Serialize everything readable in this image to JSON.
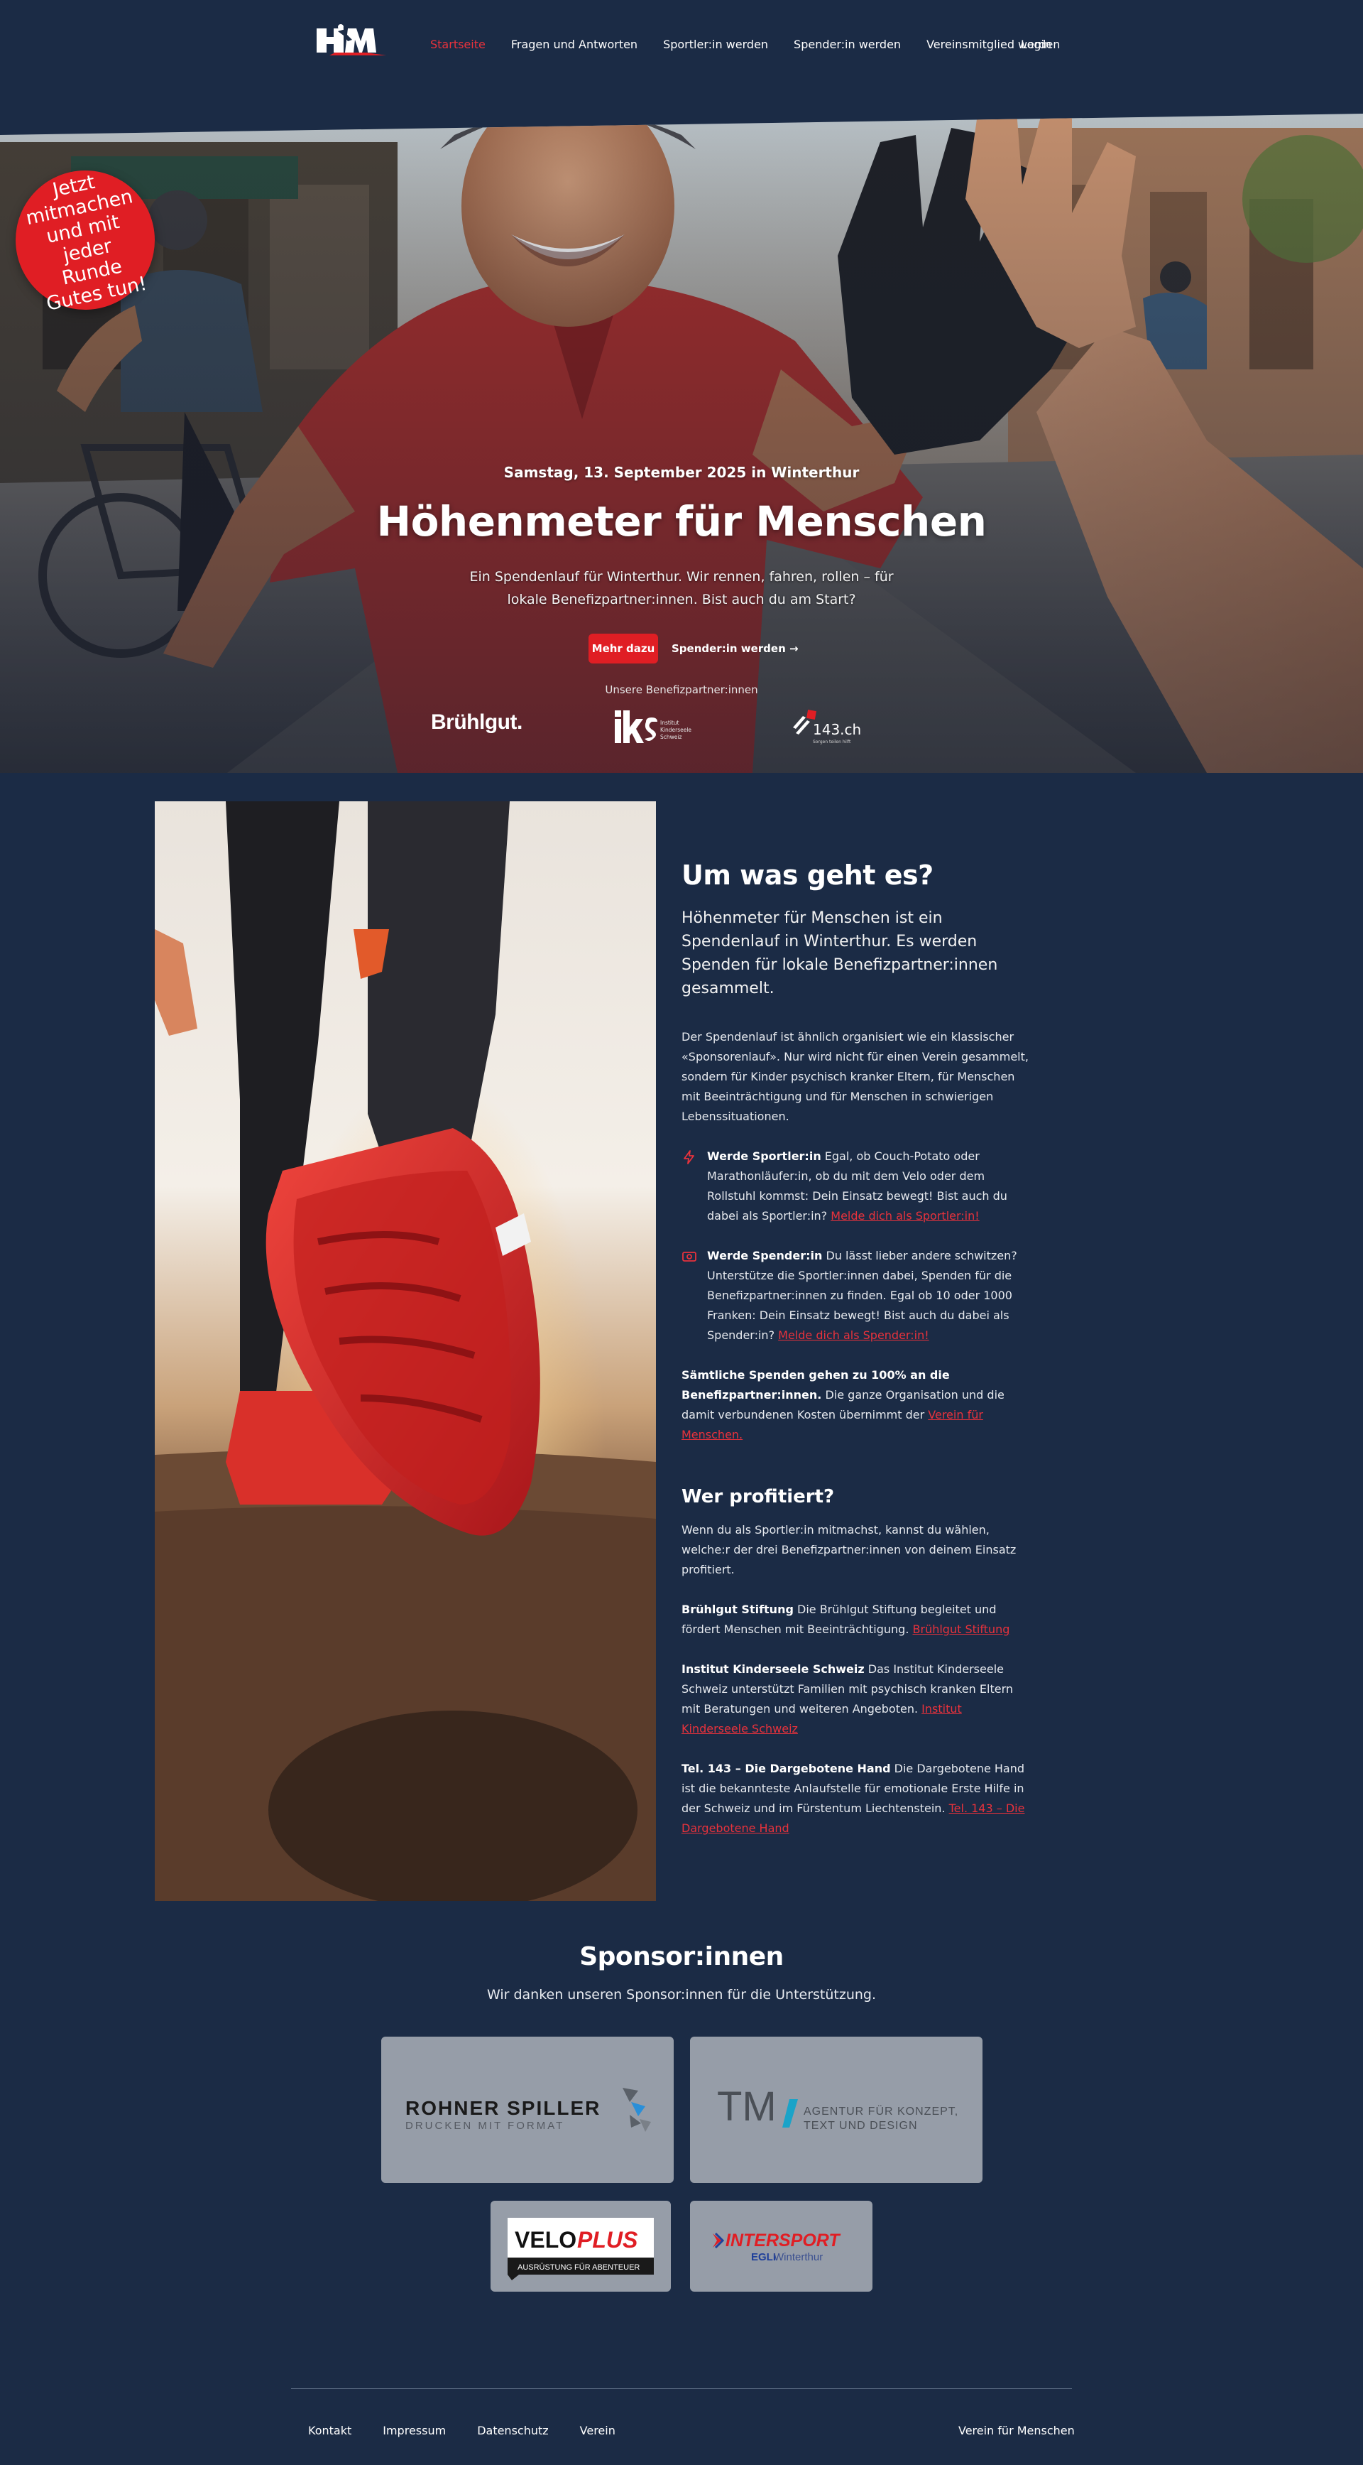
{
  "nav": {
    "logo_text": "HfM",
    "links": [
      "Startseite",
      "Fragen und Antworten",
      "Sportler:in werden",
      "Spender:in werden",
      "Vereinsmitglied werden"
    ],
    "active_index": 0,
    "login": "Login"
  },
  "hero": {
    "date": "Samstag, 13. September 2025 in Winterthur",
    "title": "Höhenmeter für Menschen",
    "subtitle": "Ein Spendenlauf für Winterthur. Wir rennen, fahren, rollen – für lokale Benefizpartner:innen. Bist auch du am Start?",
    "primary_button": "Mehr dazu",
    "secondary_button": "Spender:in werden →",
    "partners_label": "Unsere Benefizpartner:innen",
    "partners": {
      "bruehlgut": "Brühlgut.",
      "iks_letters": "iks",
      "iks_line1": "Institut",
      "iks_line2": "Kinderseele",
      "iks_line3": "Schweiz",
      "tel143": "143.ch",
      "tel143_tagline": "Sorgen teilen hilft"
    },
    "badge": "Jetzt mitmachen und mit jeder Runde Gutes tun!"
  },
  "about": {
    "heading": "Um was geht es?",
    "lead": "Höhenmeter für Menschen ist ein Spendenlauf in Winterthur. Es werden Spenden für lokale Benefizpartner:innen gesammelt.",
    "intro": "Der Spendenlauf ist ähnlich organisiert wie ein klassischer «Sponsorenlauf». Nur wird nicht für einen Verein gesammelt, sondern für Kinder psychisch kranker Eltern, für Menschen mit Beeinträchtigung und für Menschen in schwierigen Lebenssituationen.",
    "athlete": {
      "bold": "Werde Sportler:in",
      "text": " Egal, ob Couch-Potato oder Marathonläufer:in, ob du mit dem Velo oder dem Rollstuhl kommst: Dein Einsatz bewegt! Bist auch du dabei als Sportler:in? ",
      "link": "Melde dich als Sportler:in!"
    },
    "donor": {
      "bold": "Werde Spender:in",
      "text": " Du lässt lieber andere schwitzen? Unterstütze die Sportler:innen dabei, Spenden für die Benefizpartner:innen zu finden. Egal ob 10 oder 1000 Franken: Dein Einsatz bewegt! Bist auch du dabei als Spender:in? ",
      "link": "Melde dich als Spender:in!"
    },
    "donations": {
      "bold": "Sämtliche Spenden gehen zu 100% an die Benefizpartner:innen.",
      "text": " Die ganze Organisation und die damit verbundenen Kosten übernimmt der ",
      "link": "Verein für Menschen."
    },
    "beneficiaries_heading": "Wer profitiert?",
    "beneficiaries_intro": "Wenn du als Sportler:in mitmachst, kannst du wählen, welche:r der drei Benefizpartner:innen von deinem Einsatz profitiert.",
    "beneficiaries": [
      {
        "name": "Brühlgut Stiftung",
        "text": " Die Brühlgut Stiftung begleitet und fördert Menschen mit Beeinträchtigung. ",
        "link": "Brühlgut Stiftung"
      },
      {
        "name": "Institut Kinderseele Schweiz",
        "text": " Das Institut Kinderseele Schweiz unterstützt Familien mit psychisch kranken Eltern mit Beratungen und weiteren Angeboten. ",
        "link": "Institut Kinderseele Schweiz"
      },
      {
        "name": "Tel. 143 – Die Dargebotene Hand",
        "text": " Die Dargebotene Hand ist die bekannteste Anlaufstelle für emotionale Erste Hilfe in der Schweiz und im Fürstentum Liechtenstein. ",
        "link": "Tel. 143 – Die Dargebotene Hand"
      }
    ]
  },
  "sponsors": {
    "heading": "Sponsor:innen",
    "subtitle": "Wir danken unseren Sponsor:innen für die Unterstützung.",
    "rohner_name": "ROHNER SPILLER",
    "rohner_tag": "DRUCKEN MIT FORMAT",
    "tm_letters": "TM",
    "tm_line1": "AGENTUR FÜR KONZEPT,",
    "tm_line2": "TEXT UND DESIGN",
    "velo_a": "VELO",
    "velo_b": "PLUS",
    "velo_tag": "AUSRÜSTUNG FÜR ABENTEUER",
    "intersport": "INTERSPORT",
    "intersport_sub_bold": "EGLI",
    "intersport_sub": " Winterthur"
  },
  "footer": {
    "links": [
      "Kontakt",
      "Impressum",
      "Datenschutz",
      "Verein"
    ],
    "right": "Verein für Menschen"
  },
  "colors": {
    "background": "#1b2b45",
    "accent_red": "#e01e24",
    "sponsor_card": "#969da8"
  }
}
